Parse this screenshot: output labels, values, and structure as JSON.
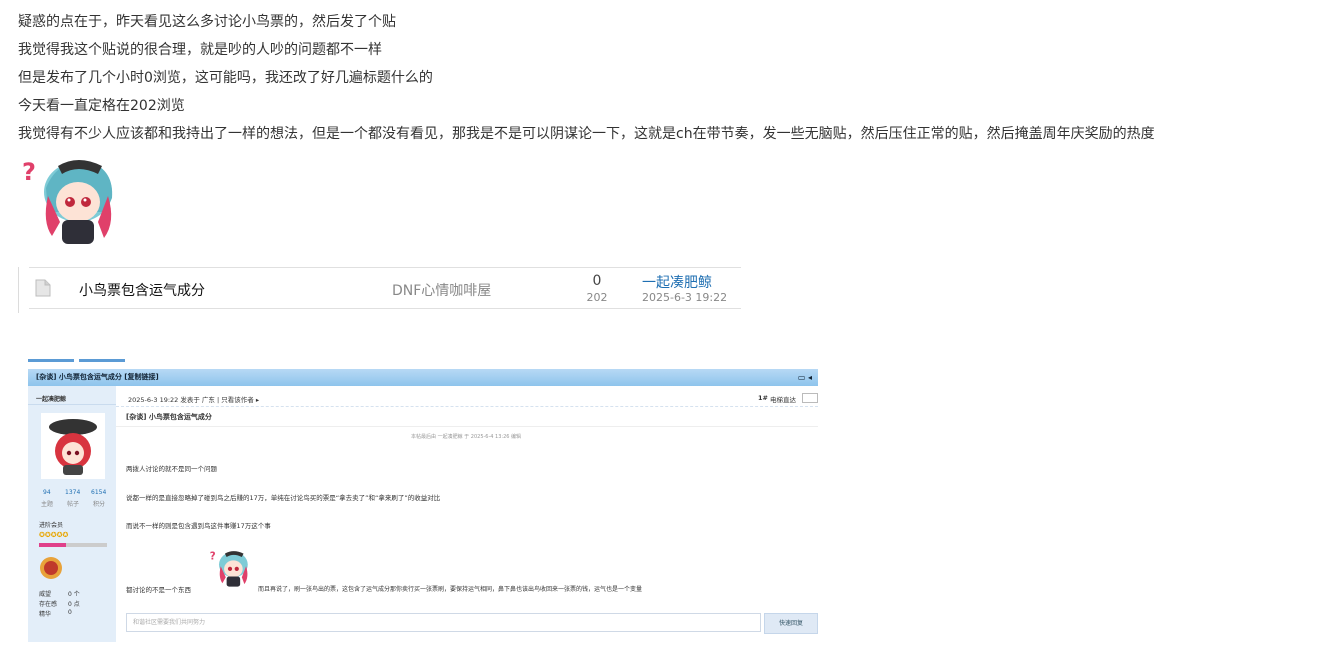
{
  "post": {
    "lines": [
      "疑惑的点在于，昨天看见这么多讨论小鸟票的，然后发了个贴",
      "我觉得我这个贴说的很合理，就是吵的人吵的问题都不一样",
      "但是发布了几个小时0浏览，这可能吗，我还改了好几遍标题什么的",
      "今天看一直定格在202浏览",
      "我觉得有不少人应该都和我持出了一样的想法，但是一个都没有看见，那我是不是可以阴谋论一下，这就是ch在带节奏，发一些无脑贴，然后压住正常的贴，然后掩盖周年庆奖励的热度"
    ],
    "sticker_icon": "anime-girl-question-sticker"
  },
  "thread": {
    "title": "小鸟票包含运气成分",
    "forum": "DNF心情咖啡屋",
    "replies": "0",
    "views": "202",
    "author": "一起凑肥鲸",
    "date": "2025-6-3 19:22"
  },
  "screenshot": {
    "header_title": "[杂谈] 小鸟票包含运气成分 [复制链接]",
    "author_name": "一起凑肥鲸",
    "stats": [
      {
        "value": "94",
        "label": "主题"
      },
      {
        "value": "1374",
        "label": "帖子"
      },
      {
        "value": "6154",
        "label": "积分"
      }
    ],
    "rank": "进阶会员",
    "profile": [
      {
        "label": "威望",
        "value": "0 个"
      },
      {
        "label": "存在感",
        "value": "0 点"
      },
      {
        "label": "精华",
        "value": "0"
      }
    ],
    "post_meta": "2025-6-3 19:22 发表于 广东 | 只看该作者 ▸",
    "floor": "1#",
    "elevator": "电梯直达",
    "post_title": "[杂谈] 小鸟票包含运气成分",
    "edit_note": "本帖最后由 一起凑肥鲸 于 2025-6-4 13:26 编辑",
    "body": [
      "两拨人讨论的就不是同一个问题",
      "说都一样的是直接忽略掉了碰到鸟之后赚的17万，单纯在讨论鸟买的票是“拿去卖了”和“拿来刷了”的收益对比",
      "而说不一样的则是包含遇到鸟这件事赚17万这个事"
    ],
    "body_last_left": "都讨论的不是一个东西",
    "body_last_right": "而且再说了，刷一张鸟出的票，这包含了运气成分那你卖行买一张票刷，要保持运气相同，鼻下鼻也该出鸟收回来一张票的钱，运气也是一个变量",
    "reply_placeholder": "和谐社区需要我们共同努力",
    "reply_button": "快速回复"
  }
}
